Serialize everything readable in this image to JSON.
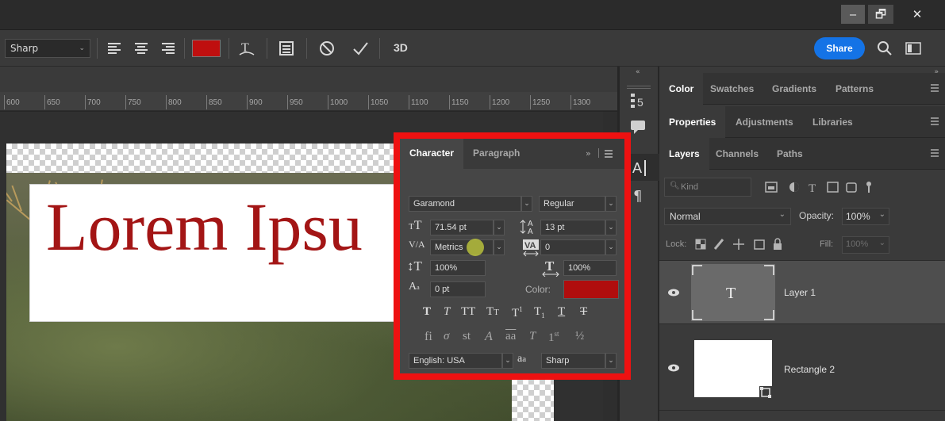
{
  "window": {
    "minimize": "‒",
    "restore": "🗗",
    "close": "✕"
  },
  "options": {
    "antialias": "Sharp",
    "color_swatch": "#bf0f0f",
    "three_d_label": "3D",
    "share_label": "Share",
    "share_color": "#1473e6"
  },
  "ruler": {
    "ticks": [
      "600",
      "650",
      "700",
      "750",
      "800",
      "850",
      "900",
      "950",
      "1000",
      "1050",
      "1100",
      "1150",
      "1200",
      "1250",
      "1300"
    ]
  },
  "canvas": {
    "text": "Lorem Ipsu",
    "text_color": "#a31515"
  },
  "character": {
    "tabs": [
      "Character",
      "Paragraph"
    ],
    "font_family": "Garamond",
    "font_style": "Regular",
    "font_size": "71.54 pt",
    "leading": "13 pt",
    "kerning": "Metrics",
    "tracking": "0",
    "vertical_scale": "100%",
    "horizontal_scale": "100%",
    "baseline_shift": "0 pt",
    "color_label": "Color:",
    "color": "#b00d0d",
    "language": "English: USA",
    "aa_label": "a",
    "antialias": "Sharp"
  },
  "panels": {
    "row1": [
      "Color",
      "Swatches",
      "Gradients",
      "Patterns"
    ],
    "row2": [
      "Properties",
      "Adjustments",
      "Libraries"
    ],
    "row3": [
      "Layers",
      "Channels",
      "Paths"
    ]
  },
  "layers": {
    "kind_placeholder": "Kind",
    "blend_mode": "Normal",
    "opacity_label": "Opacity:",
    "opacity_value": "100%",
    "lock_label": "Lock:",
    "fill_label": "Fill:",
    "fill_value": "100%",
    "items": [
      {
        "name": "Layer 1",
        "thumb": "T"
      },
      {
        "name": "Rectangle 2",
        "thumb": ""
      }
    ]
  }
}
